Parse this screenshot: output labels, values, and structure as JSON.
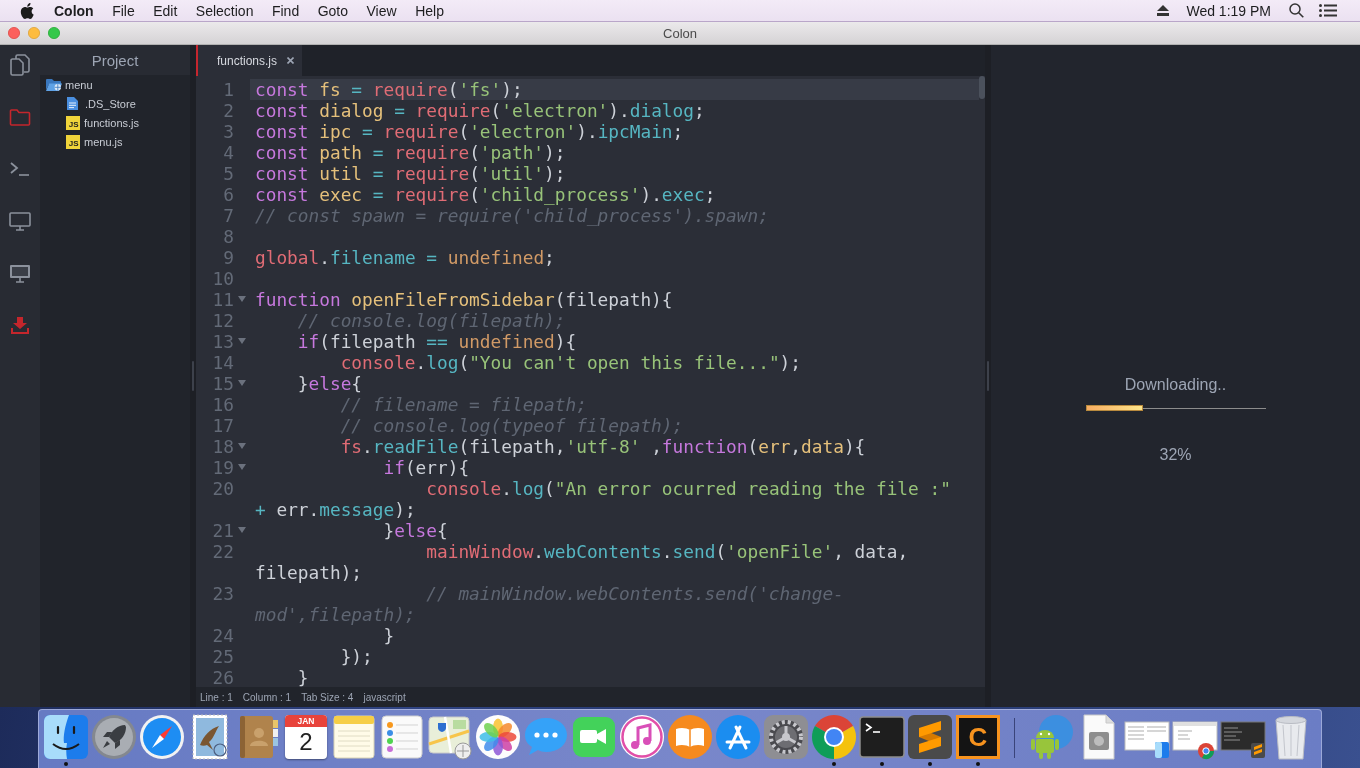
{
  "menu_bar": {
    "app_name": "Colon",
    "items": [
      "File",
      "Edit",
      "Selection",
      "Find",
      "Goto",
      "View",
      "Help"
    ],
    "clock": "Wed 1:19 PM"
  },
  "window": {
    "title": "Colon"
  },
  "activity_bar": {
    "items": [
      {
        "kind": "files",
        "selected": false
      },
      {
        "kind": "folder",
        "selected": true
      },
      {
        "kind": "terminal",
        "selected": false
      },
      {
        "kind": "monitor",
        "selected": false
      },
      {
        "kind": "display",
        "selected": false
      },
      {
        "kind": "download",
        "selected": true
      }
    ]
  },
  "sidebar": {
    "title": "Project",
    "tree": [
      {
        "name": "menu",
        "kind": "folder",
        "expanded": true,
        "children": [
          {
            "name": ".DS_Store",
            "kind": "text"
          },
          {
            "name": "functions.js",
            "kind": "script",
            "badge": "JS"
          },
          {
            "name": "menu.js",
            "kind": "script",
            "badge": "JS"
          }
        ]
      }
    ]
  },
  "editor": {
    "tabs": [
      {
        "label": "functions.js",
        "selected": true
      }
    ],
    "lines": [
      {
        "number": "1",
        "foldable": false,
        "current": true,
        "rows": [
          [
            {
              "kind": "keyword",
              "text": "const "
            },
            {
              "kind": "declaration",
              "text": "fs "
            },
            {
              "kind": "operator",
              "text": "= "
            },
            {
              "kind": "builtin",
              "text": "require"
            },
            {
              "kind": "plain",
              "text": "("
            },
            {
              "kind": "string",
              "text": "'fs'"
            },
            {
              "kind": "plain",
              "text": ");"
            }
          ]
        ]
      },
      {
        "number": "2",
        "foldable": false,
        "current": false,
        "rows": [
          [
            {
              "kind": "keyword",
              "text": "const "
            },
            {
              "kind": "declaration",
              "text": "dialog "
            },
            {
              "kind": "operator",
              "text": "= "
            },
            {
              "kind": "builtin",
              "text": "require"
            },
            {
              "kind": "plain",
              "text": "("
            },
            {
              "kind": "string",
              "text": "'electron'"
            },
            {
              "kind": "plain",
              "text": ")."
            },
            {
              "kind": "property",
              "text": "dialog"
            },
            {
              "kind": "plain",
              "text": ";"
            }
          ]
        ]
      },
      {
        "number": "3",
        "foldable": false,
        "current": false,
        "rows": [
          [
            {
              "kind": "keyword",
              "text": "const "
            },
            {
              "kind": "declaration",
              "text": "ipc "
            },
            {
              "kind": "operator",
              "text": "= "
            },
            {
              "kind": "builtin",
              "text": "require"
            },
            {
              "kind": "plain",
              "text": "("
            },
            {
              "kind": "string",
              "text": "'electron'"
            },
            {
              "kind": "plain",
              "text": ")."
            },
            {
              "kind": "property",
              "text": "ipcMain"
            },
            {
              "kind": "plain",
              "text": ";"
            }
          ]
        ]
      },
      {
        "number": "4",
        "foldable": false,
        "current": false,
        "rows": [
          [
            {
              "kind": "keyword",
              "text": "const "
            },
            {
              "kind": "declaration",
              "text": "path "
            },
            {
              "kind": "operator",
              "text": "= "
            },
            {
              "kind": "builtin",
              "text": "require"
            },
            {
              "kind": "plain",
              "text": "("
            },
            {
              "kind": "string",
              "text": "'path'"
            },
            {
              "kind": "plain",
              "text": ");"
            }
          ]
        ]
      },
      {
        "number": "5",
        "foldable": false,
        "current": false,
        "rows": [
          [
            {
              "kind": "keyword",
              "text": "const "
            },
            {
              "kind": "declaration",
              "text": "util "
            },
            {
              "kind": "operator",
              "text": "= "
            },
            {
              "kind": "builtin",
              "text": "require"
            },
            {
              "kind": "plain",
              "text": "("
            },
            {
              "kind": "string",
              "text": "'util'"
            },
            {
              "kind": "plain",
              "text": ");"
            }
          ]
        ]
      },
      {
        "number": "6",
        "foldable": false,
        "current": false,
        "rows": [
          [
            {
              "kind": "keyword",
              "text": "const "
            },
            {
              "kind": "declaration",
              "text": "exec "
            },
            {
              "kind": "operator",
              "text": "= "
            },
            {
              "kind": "builtin",
              "text": "require"
            },
            {
              "kind": "plain",
              "text": "("
            },
            {
              "kind": "string",
              "text": "'child_process'"
            },
            {
              "kind": "plain",
              "text": ")."
            },
            {
              "kind": "property",
              "text": "exec"
            },
            {
              "kind": "plain",
              "text": ";"
            }
          ]
        ]
      },
      {
        "number": "7",
        "foldable": false,
        "current": false,
        "rows": [
          [
            {
              "kind": "comment",
              "text": "// const spawn = require('child_process').spawn;"
            }
          ]
        ]
      },
      {
        "number": "8",
        "foldable": false,
        "current": false
      },
      {
        "number": "9",
        "foldable": false,
        "current": false,
        "rows": [
          [
            {
              "kind": "builtin",
              "text": "global"
            },
            {
              "kind": "plain",
              "text": "."
            },
            {
              "kind": "property",
              "text": "filename"
            },
            {
              "kind": "plain",
              "text": " "
            },
            {
              "kind": "operator",
              "text": "= "
            },
            {
              "kind": "constant",
              "text": "undefined"
            },
            {
              "kind": "plain",
              "text": ";"
            }
          ]
        ]
      },
      {
        "number": "10",
        "foldable": false,
        "current": false
      },
      {
        "number": "11",
        "foldable": true,
        "current": false,
        "rows": [
          [
            {
              "kind": "keyword",
              "text": "function "
            },
            {
              "kind": "declaration",
              "text": "openFileFromSidebar"
            },
            {
              "kind": "plain",
              "text": "(filepath){"
            }
          ]
        ]
      },
      {
        "number": "12",
        "foldable": false,
        "current": false,
        "rows": [
          [
            {
              "kind": "comment",
              "text": "    // console.log(filepath);"
            }
          ]
        ]
      },
      {
        "number": "13",
        "foldable": true,
        "current": false,
        "rows": [
          [
            {
              "kind": "keyword",
              "text": "    if"
            },
            {
              "kind": "plain",
              "text": "(filepath "
            },
            {
              "kind": "operator",
              "text": "== "
            },
            {
              "kind": "constant",
              "text": "undefined"
            },
            {
              "kind": "plain",
              "text": "){"
            }
          ]
        ]
      },
      {
        "number": "14",
        "foldable": false,
        "current": false,
        "rows": [
          [
            {
              "kind": "builtin",
              "text": "        console"
            },
            {
              "kind": "plain",
              "text": "."
            },
            {
              "kind": "property",
              "text": "log"
            },
            {
              "kind": "plain",
              "text": "("
            },
            {
              "kind": "string",
              "text": "\"You can't open this file...\""
            },
            {
              "kind": "plain",
              "text": ");"
            }
          ]
        ]
      },
      {
        "number": "15",
        "foldable": true,
        "current": false,
        "rows": [
          [
            {
              "kind": "plain",
              "text": "    }"
            },
            {
              "kind": "keyword",
              "text": "else"
            },
            {
              "kind": "plain",
              "text": "{"
            }
          ]
        ]
      },
      {
        "number": "16",
        "foldable": false,
        "current": false,
        "rows": [
          [
            {
              "kind": "comment",
              "text": "        // filename = filepath;"
            }
          ]
        ]
      },
      {
        "number": "17",
        "foldable": false,
        "current": false,
        "rows": [
          [
            {
              "kind": "comment",
              "text": "        // console.log(typeof filepath);"
            }
          ]
        ]
      },
      {
        "number": "18",
        "foldable": true,
        "current": false,
        "rows": [
          [
            {
              "kind": "builtin",
              "text": "        fs"
            },
            {
              "kind": "plain",
              "text": "."
            },
            {
              "kind": "property",
              "text": "readFile"
            },
            {
              "kind": "plain",
              "text": "(filepath,"
            },
            {
              "kind": "string",
              "text": "'utf-8'"
            },
            {
              "kind": "plain",
              "text": " ,"
            },
            {
              "kind": "keyword",
              "text": "function"
            },
            {
              "kind": "plain",
              "text": "("
            },
            {
              "kind": "parameter",
              "text": "err"
            },
            {
              "kind": "plain",
              "text": ","
            },
            {
              "kind": "parameter",
              "text": "data"
            },
            {
              "kind": "plain",
              "text": "){"
            }
          ]
        ]
      },
      {
        "number": "19",
        "foldable": true,
        "current": false,
        "rows": [
          [
            {
              "kind": "keyword",
              "text": "            if"
            },
            {
              "kind": "plain",
              "text": "(err){"
            }
          ]
        ]
      },
      {
        "number": "20",
        "foldable": false,
        "current": false,
        "rows": [
          [
            {
              "kind": "builtin",
              "text": "                console"
            },
            {
              "kind": "plain",
              "text": "."
            },
            {
              "kind": "property",
              "text": "log"
            },
            {
              "kind": "plain",
              "text": "("
            },
            {
              "kind": "string",
              "text": "\"An error ocurred reading the file :\""
            }
          ],
          [
            {
              "kind": "operator",
              "text": "+ "
            },
            {
              "kind": "plain",
              "text": "err."
            },
            {
              "kind": "property",
              "text": "message"
            },
            {
              "kind": "plain",
              "text": ");"
            }
          ]
        ]
      },
      {
        "number": "21",
        "foldable": true,
        "current": false,
        "rows": [
          [
            {
              "kind": "plain",
              "text": "            }"
            },
            {
              "kind": "keyword",
              "text": "else"
            },
            {
              "kind": "plain",
              "text": "{"
            }
          ]
        ]
      },
      {
        "number": "22",
        "foldable": false,
        "current": false,
        "rows": [
          [
            {
              "kind": "builtin",
              "text": "                mainWindow"
            },
            {
              "kind": "plain",
              "text": "."
            },
            {
              "kind": "property",
              "text": "webContents"
            },
            {
              "kind": "plain",
              "text": "."
            },
            {
              "kind": "property",
              "text": "send"
            },
            {
              "kind": "plain",
              "text": "("
            },
            {
              "kind": "string",
              "text": "'openFile'"
            },
            {
              "kind": "plain",
              "text": ", data,"
            }
          ],
          [
            {
              "kind": "plain",
              "text": "filepath);"
            }
          ]
        ]
      },
      {
        "number": "23",
        "foldable": false,
        "current": false,
        "rows": [
          [
            {
              "kind": "comment",
              "text": "                // mainWindow.webContents.send('change-"
            }
          ],
          [
            {
              "kind": "comment",
              "text": "mod',filepath);"
            }
          ]
        ]
      },
      {
        "number": "24",
        "foldable": false,
        "current": false,
        "rows": [
          [
            {
              "kind": "plain",
              "text": "            }"
            }
          ]
        ]
      },
      {
        "number": "25",
        "foldable": false,
        "current": false,
        "rows": [
          [
            {
              "kind": "plain",
              "text": "        });"
            }
          ]
        ]
      },
      {
        "number": "26",
        "foldable": false,
        "current": false,
        "rows": [
          [
            {
              "kind": "plain",
              "text": "    }"
            }
          ]
        ]
      }
    ]
  },
  "status_bar": {
    "items": [
      "Line : 1",
      "Column : 1",
      "Tab Size : 4",
      "javascript"
    ]
  },
  "download": {
    "label": "Downloading..",
    "level": 0.32,
    "percent": "32%"
  },
  "dock": {
    "apps": [
      {
        "kind": "finder",
        "running": true
      },
      {
        "kind": "launchpad",
        "running": false
      },
      {
        "kind": "safari",
        "running": false
      },
      {
        "kind": "mail",
        "running": false
      },
      {
        "kind": "contacts",
        "running": false
      },
      {
        "kind": "calendar",
        "running": false,
        "month": "JAN",
        "day": "2"
      },
      {
        "kind": "notes",
        "running": false
      },
      {
        "kind": "reminders",
        "running": false
      },
      {
        "kind": "maps",
        "running": false
      },
      {
        "kind": "photos",
        "running": false
      },
      {
        "kind": "messages",
        "running": false
      },
      {
        "kind": "facetime",
        "running": false
      },
      {
        "kind": "itunes",
        "running": false
      },
      {
        "kind": "books",
        "running": false
      },
      {
        "kind": "appstore",
        "running": false
      },
      {
        "kind": "preferences",
        "running": false
      },
      {
        "kind": "chrome",
        "running": true
      },
      {
        "kind": "terminal",
        "running": true
      },
      {
        "kind": "sublime",
        "running": true
      },
      {
        "kind": "colon",
        "running": true,
        "letter": "C"
      }
    ],
    "others": [
      {
        "kind": "android"
      },
      {
        "kind": "document"
      },
      {
        "kind": "window_finder"
      },
      {
        "kind": "window_browser"
      },
      {
        "kind": "window_editor"
      },
      {
        "kind": "trash"
      }
    ]
  }
}
